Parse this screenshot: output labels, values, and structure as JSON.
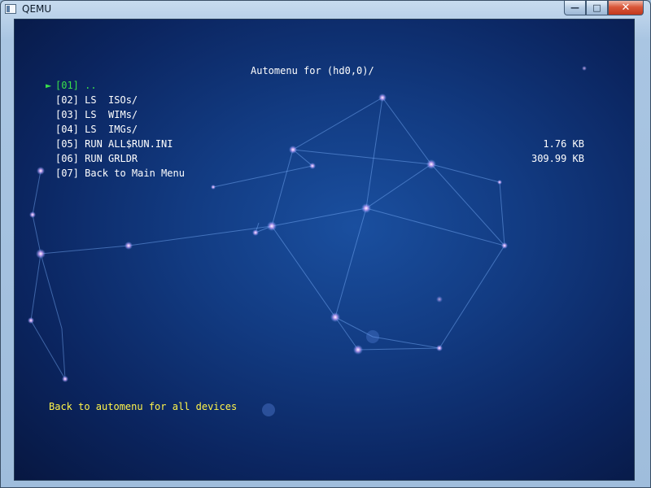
{
  "window": {
    "title": "QEMU",
    "controls": {
      "minimize": "—",
      "maximize": "□",
      "close": "✕"
    }
  },
  "screen": {
    "header": "Automenu for (hd0,0)/",
    "selector_glyph": "►",
    "menu_items": [
      {
        "label": "[01] ..",
        "size": "",
        "selected": true
      },
      {
        "label": "[02] LS  ISOs/",
        "size": "",
        "selected": false
      },
      {
        "label": "[03] LS  WIMs/",
        "size": "",
        "selected": false
      },
      {
        "label": "[04] LS  IMGs/",
        "size": "",
        "selected": false
      },
      {
        "label": "[05] RUN ALL$RUN.INI",
        "size": "1.76 KB",
        "selected": false
      },
      {
        "label": "[06] RUN GRLDR",
        "size": "309.99 KB",
        "selected": false
      },
      {
        "label": "[07] Back to Main Menu",
        "size": "",
        "selected": false
      }
    ],
    "hint": "Back to automenu for all devices"
  },
  "colors": {
    "selected_text": "#39e04a",
    "normal_text": "#ffffff",
    "hint_text": "#fff44a",
    "background": "#123b82"
  },
  "icons": {
    "app": "qemu-window-icon",
    "selector": "triangle-right-icon"
  }
}
